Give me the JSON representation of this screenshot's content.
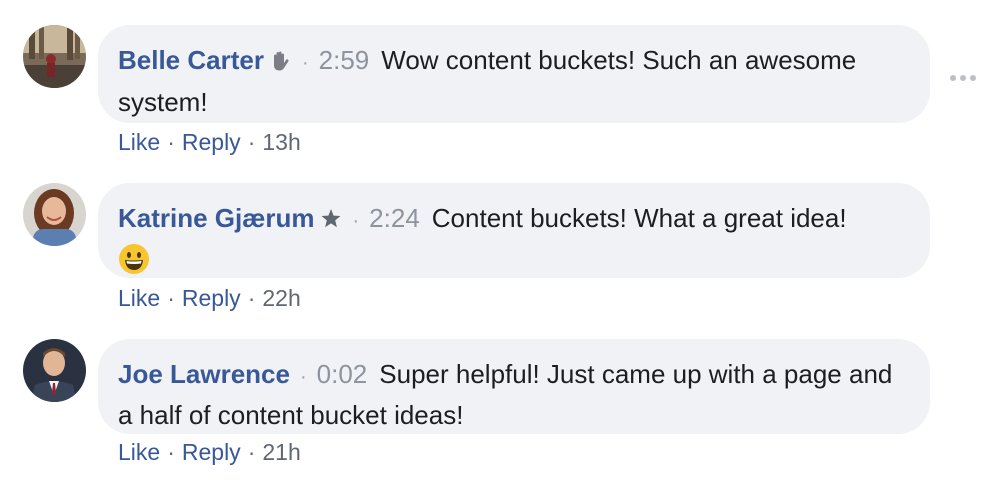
{
  "comments": [
    {
      "author": "Belle Carter",
      "badge_icon": "wave-hand-icon",
      "separator": "·",
      "timestamp": "2:59",
      "text": "Wow content buckets! Such an awesome system!",
      "actions": {
        "like": "Like",
        "dot": "·",
        "reply": "Reply",
        "age": "13h"
      }
    },
    {
      "author": "Katrine Gjærum",
      "badge_icon": "star-badge-icon",
      "separator": "·",
      "timestamp": "2:24",
      "text": "Content buckets! What a great idea!",
      "emoji": "grinning-face-emoji",
      "actions": {
        "like": "Like",
        "dot": "·",
        "reply": "Reply",
        "age": "22h"
      }
    },
    {
      "author": "Joe Lawrence",
      "separator": "·",
      "timestamp": "0:02",
      "text": "Super helpful! Just came up with a page and a half of content bucket ideas!",
      "actions": {
        "like": "Like",
        "dot": "·",
        "reply": "Reply",
        "age": "21h"
      }
    }
  ],
  "more_menu_icon": "more-options-icon",
  "colors": {
    "link": "#385898",
    "bubble": "#f1f2f5",
    "meta": "#606770",
    "timestamp": "#8d949e"
  }
}
